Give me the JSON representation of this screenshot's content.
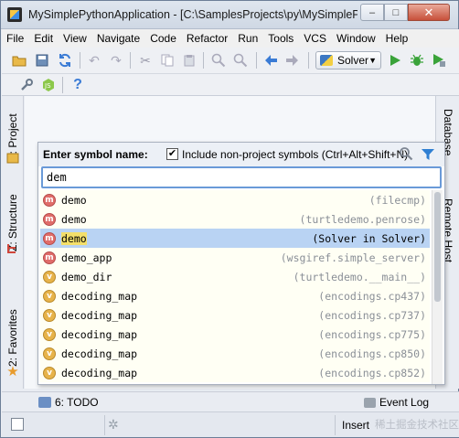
{
  "window": {
    "title": "MySimplePythonApplication - [C:\\SamplesProjects\\py\\MySimplePy",
    "minimize_label": "–",
    "maximize_label": "□",
    "close_label": "✕"
  },
  "menu": [
    "File",
    "Edit",
    "View",
    "Navigate",
    "Code",
    "Refactor",
    "Run",
    "Tools",
    "VCS",
    "Window",
    "Help"
  ],
  "toolbar": {
    "run_config": "Solver"
  },
  "side_tabs": {
    "left": [
      "1: Project",
      "Z: Structure",
      "2: Favorites"
    ],
    "right": [
      "Database",
      "Remote Host"
    ]
  },
  "popup": {
    "label": "Enter symbol name:",
    "checkbox_checked": "✔",
    "checkbox_label": "Include non-project symbols (Ctrl+Alt+Shift+N)",
    "query": "dem",
    "results": [
      {
        "kind": "m",
        "name": "demo",
        "location": "(filecmp)",
        "selected": false
      },
      {
        "kind": "m",
        "name": "demo",
        "location": "(turtledemo.penrose)",
        "selected": false
      },
      {
        "kind": "m",
        "name": "demo",
        "location": "(Solver in Solver)",
        "selected": true
      },
      {
        "kind": "m",
        "name": "demo_app",
        "location": "(wsgiref.simple_server)",
        "selected": false
      },
      {
        "kind": "v",
        "name": "demo_dir",
        "location": "(turtledemo.__main__)",
        "selected": false
      },
      {
        "kind": "v",
        "name": "decoding_map",
        "location": "(encodings.cp437)",
        "selected": false
      },
      {
        "kind": "v",
        "name": "decoding_map",
        "location": "(encodings.cp737)",
        "selected": false
      },
      {
        "kind": "v",
        "name": "decoding_map",
        "location": "(encodings.cp775)",
        "selected": false
      },
      {
        "kind": "v",
        "name": "decoding_map",
        "location": "(encodings.cp850)",
        "selected": false
      },
      {
        "kind": "v",
        "name": "decoding_map",
        "location": "(encodings.cp852)",
        "selected": false
      }
    ]
  },
  "bottom_bar": {
    "todo": "6: TODO",
    "event_log": "Event Log"
  },
  "status_bar": {
    "insert": "Insert",
    "watermark": "稀土掘金技术社区"
  },
  "colors": {
    "selection": "#b9d3f3",
    "method_badge": "#e06d6a",
    "variable_badge": "#e7b34a"
  }
}
